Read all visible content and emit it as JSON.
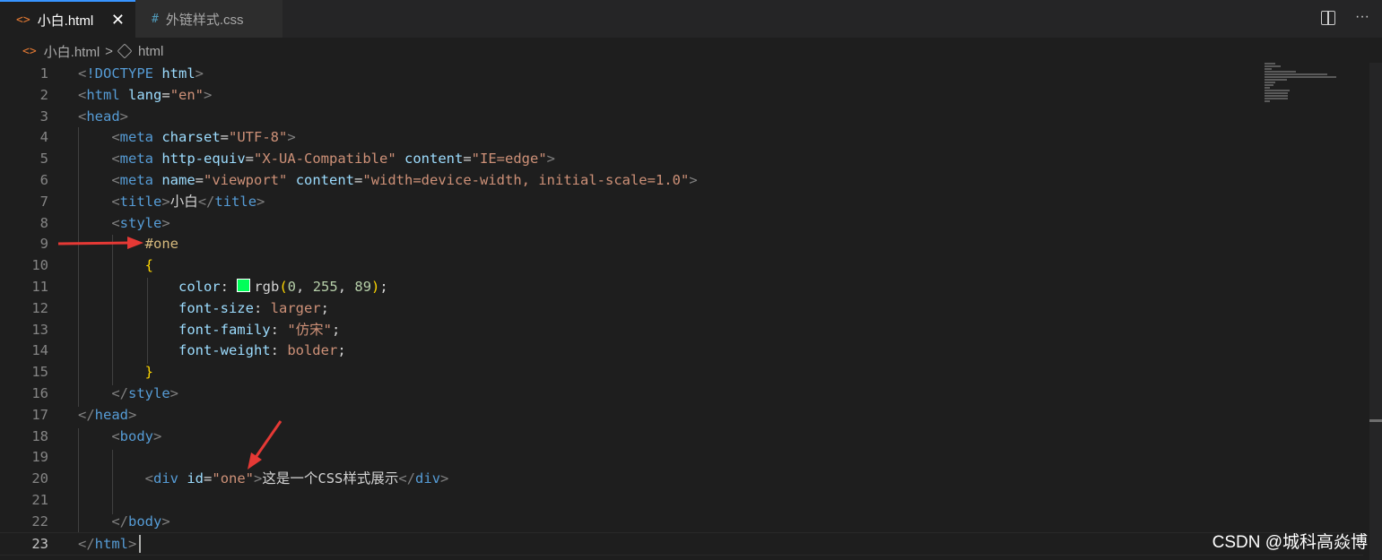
{
  "tabs": [
    {
      "icon": "<>",
      "label": "小白.html",
      "close": "✕"
    },
    {
      "icon": "#",
      "label": "外链样式.css"
    }
  ],
  "tab_actions": {
    "more": "···"
  },
  "breadcrumb": {
    "file": "小白.html",
    "separator": ">",
    "node": "html"
  },
  "editor": {
    "current_line": 23,
    "lines": [
      {
        "n": "1",
        "segs": [
          [
            "t-punc",
            "<"
          ],
          [
            "t-tag",
            "!DOCTYPE"
          ],
          [
            "t-text",
            " "
          ],
          [
            "t-attr",
            "html"
          ],
          [
            "t-punc",
            ">"
          ]
        ]
      },
      {
        "n": "2",
        "segs": [
          [
            "t-punc",
            "<"
          ],
          [
            "t-tag",
            "html"
          ],
          [
            "t-text",
            " "
          ],
          [
            "t-attr",
            "lang"
          ],
          [
            "t-text",
            "="
          ],
          [
            "t-str",
            "\"en\""
          ],
          [
            "t-punc",
            ">"
          ]
        ]
      },
      {
        "n": "3",
        "segs": [
          [
            "t-punc",
            "<"
          ],
          [
            "t-tag",
            "head"
          ],
          [
            "t-punc",
            ">"
          ]
        ]
      },
      {
        "n": "4",
        "segs": [
          [
            "t-text",
            "    "
          ],
          [
            "t-punc",
            "<"
          ],
          [
            "t-tag",
            "meta"
          ],
          [
            "t-text",
            " "
          ],
          [
            "t-attr",
            "charset"
          ],
          [
            "t-text",
            "="
          ],
          [
            "t-str",
            "\"UTF-8\""
          ],
          [
            "t-punc",
            ">"
          ]
        ]
      },
      {
        "n": "5",
        "segs": [
          [
            "t-text",
            "    "
          ],
          [
            "t-punc",
            "<"
          ],
          [
            "t-tag",
            "meta"
          ],
          [
            "t-text",
            " "
          ],
          [
            "t-attr",
            "http-equiv"
          ],
          [
            "t-text",
            "="
          ],
          [
            "t-str",
            "\"X-UA-Compatible\""
          ],
          [
            "t-text",
            " "
          ],
          [
            "t-attr",
            "content"
          ],
          [
            "t-text",
            "="
          ],
          [
            "t-str",
            "\"IE=edge\""
          ],
          [
            "t-punc",
            ">"
          ]
        ]
      },
      {
        "n": "6",
        "segs": [
          [
            "t-text",
            "    "
          ],
          [
            "t-punc",
            "<"
          ],
          [
            "t-tag",
            "meta"
          ],
          [
            "t-text",
            " "
          ],
          [
            "t-attr",
            "name"
          ],
          [
            "t-text",
            "="
          ],
          [
            "t-str",
            "\"viewport\""
          ],
          [
            "t-text",
            " "
          ],
          [
            "t-attr",
            "content"
          ],
          [
            "t-text",
            "="
          ],
          [
            "t-str",
            "\"width=device-width, initial-scale=1.0\""
          ],
          [
            "t-punc",
            ">"
          ]
        ]
      },
      {
        "n": "7",
        "segs": [
          [
            "t-text",
            "    "
          ],
          [
            "t-punc",
            "<"
          ],
          [
            "t-tag",
            "title"
          ],
          [
            "t-punc",
            ">"
          ],
          [
            "t-text",
            "小白"
          ],
          [
            "t-punc",
            "</"
          ],
          [
            "t-tag",
            "title"
          ],
          [
            "t-punc",
            ">"
          ]
        ]
      },
      {
        "n": "8",
        "segs": [
          [
            "t-text",
            "    "
          ],
          [
            "t-punc",
            "<"
          ],
          [
            "t-tag",
            "style"
          ],
          [
            "t-punc",
            ">"
          ]
        ]
      },
      {
        "n": "9",
        "segs": [
          [
            "t-text",
            "        "
          ],
          [
            "t-sel",
            "#one"
          ]
        ]
      },
      {
        "n": "10",
        "segs": [
          [
            "t-text",
            "        "
          ],
          [
            "t-brace",
            "{"
          ]
        ]
      },
      {
        "n": "11",
        "segs": [
          [
            "t-text",
            "            "
          ],
          [
            "t-attr",
            "color"
          ],
          [
            "t-text",
            ": "
          ],
          [
            "swatch",
            ""
          ],
          [
            "t-text",
            "rgb"
          ],
          [
            "t-brace",
            "("
          ],
          [
            "t-num",
            "0"
          ],
          [
            "t-text",
            ", "
          ],
          [
            "t-num",
            "255"
          ],
          [
            "t-text",
            ", "
          ],
          [
            "t-num",
            "89"
          ],
          [
            "t-brace",
            ")"
          ],
          [
            "t-text",
            ";"
          ]
        ]
      },
      {
        "n": "12",
        "segs": [
          [
            "t-text",
            "            "
          ],
          [
            "t-attr",
            "font-size"
          ],
          [
            "t-text",
            ": "
          ],
          [
            "t-val",
            "larger"
          ],
          [
            "t-text",
            ";"
          ]
        ]
      },
      {
        "n": "13",
        "segs": [
          [
            "t-text",
            "            "
          ],
          [
            "t-attr",
            "font-family"
          ],
          [
            "t-text",
            ": "
          ],
          [
            "t-str",
            "\"仿宋\""
          ],
          [
            "t-text",
            ";"
          ]
        ]
      },
      {
        "n": "14",
        "segs": [
          [
            "t-text",
            "            "
          ],
          [
            "t-attr",
            "font-weight"
          ],
          [
            "t-text",
            ": "
          ],
          [
            "t-val",
            "bolder"
          ],
          [
            "t-text",
            ";"
          ]
        ]
      },
      {
        "n": "15",
        "segs": [
          [
            "t-text",
            "        "
          ],
          [
            "t-brace",
            "}"
          ]
        ]
      },
      {
        "n": "16",
        "segs": [
          [
            "t-text",
            "    "
          ],
          [
            "t-punc",
            "</"
          ],
          [
            "t-tag",
            "style"
          ],
          [
            "t-punc",
            ">"
          ]
        ]
      },
      {
        "n": "17",
        "segs": [
          [
            "t-punc",
            "</"
          ],
          [
            "t-tag",
            "head"
          ],
          [
            "t-punc",
            ">"
          ]
        ]
      },
      {
        "n": "18",
        "segs": [
          [
            "t-text",
            "    "
          ],
          [
            "t-punc",
            "<"
          ],
          [
            "t-tag",
            "body"
          ],
          [
            "t-punc",
            ">"
          ]
        ]
      },
      {
        "n": "19",
        "segs": []
      },
      {
        "n": "20",
        "segs": [
          [
            "t-text",
            "        "
          ],
          [
            "t-punc",
            "<"
          ],
          [
            "t-tag",
            "div"
          ],
          [
            "t-text",
            " "
          ],
          [
            "t-attr",
            "id"
          ],
          [
            "t-text",
            "="
          ],
          [
            "t-str",
            "\"one\""
          ],
          [
            "t-punc",
            ">"
          ],
          [
            "t-text",
            "这是一个CSS样式展示"
          ],
          [
            "t-punc",
            "</"
          ],
          [
            "t-tag",
            "div"
          ],
          [
            "t-punc",
            ">"
          ]
        ]
      },
      {
        "n": "21",
        "segs": []
      },
      {
        "n": "22",
        "segs": [
          [
            "t-text",
            "    "
          ],
          [
            "t-punc",
            "</"
          ],
          [
            "t-tag",
            "body"
          ],
          [
            "t-punc",
            ">"
          ]
        ]
      },
      {
        "n": "23",
        "segs": [
          [
            "t-punc",
            "</"
          ],
          [
            "t-tag",
            "html"
          ],
          [
            "t-punc",
            ">"
          ]
        ]
      }
    ]
  },
  "watermark": "CSDN @城科高焱博",
  "colors": {
    "accent": "#3794ff",
    "arrow": "#e53935",
    "swatch": "#00ff59"
  }
}
